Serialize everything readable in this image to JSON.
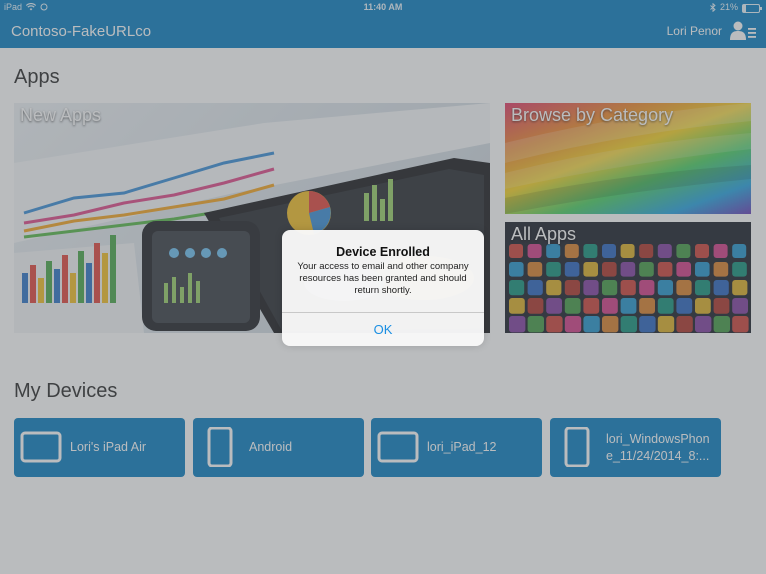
{
  "status_bar": {
    "device": "iPad",
    "time": "11:40 AM",
    "battery": "21%",
    "battery_level_percent": 21
  },
  "header": {
    "title": "Contoso-FakeURLco",
    "user_name": "Lori Penor",
    "user_icon": "user-menu-icon"
  },
  "apps": {
    "section_title": "Apps",
    "tiles": [
      {
        "label": "New Apps"
      },
      {
        "label": "Browse by Category"
      },
      {
        "label": "All Apps"
      }
    ]
  },
  "devices": {
    "section_title": "My Devices",
    "items": [
      {
        "label": "Lori's iPad Air",
        "icon": "tablet-landscape-icon"
      },
      {
        "label": "Android",
        "icon": "phone-icon"
      },
      {
        "label": "lori_iPad_12",
        "icon": "tablet-landscape-icon"
      },
      {
        "label": "lori_WindowsPhone_11/24/2014_8:...",
        "icon": "phone-icon"
      }
    ]
  },
  "alert": {
    "title": "Device Enrolled",
    "message": "Your access to email and other company resources has been granted and should return shortly.",
    "ok_label": "OK"
  },
  "colors": {
    "brand_blue": "#0b7fc2",
    "ios_link": "#1a8fe3"
  }
}
